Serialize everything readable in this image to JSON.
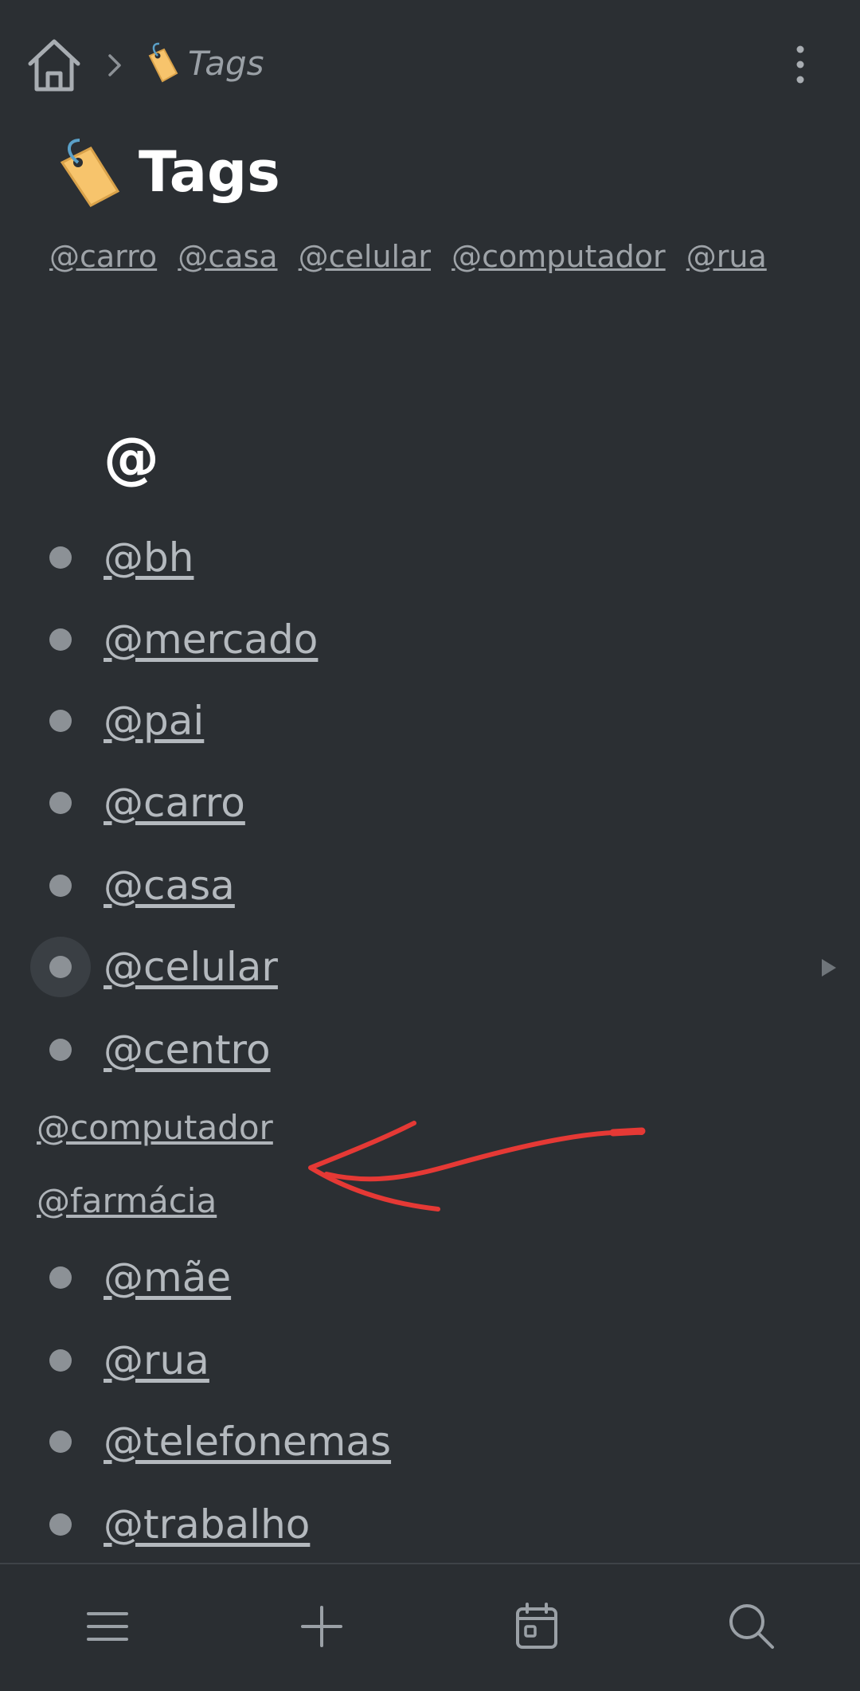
{
  "breadcrumb": {
    "label": "Tags"
  },
  "page": {
    "title": "Tags"
  },
  "tag_row": [
    "@carro",
    "@casa",
    "@celular",
    "@computador",
    "@rua"
  ],
  "section_heading": "@",
  "list_items": [
    {
      "label": "@bh"
    },
    {
      "label": "@mercado"
    },
    {
      "label": "@pai"
    },
    {
      "label": "@carro"
    },
    {
      "label": "@casa"
    },
    {
      "label": "@celular"
    },
    {
      "label": "@centro"
    }
  ],
  "loose_items": [
    {
      "label": "@computador"
    },
    {
      "label": "@farmácia"
    }
  ],
  "list_items_after": [
    {
      "label": "@mãe"
    },
    {
      "label": "@rua"
    },
    {
      "label": "@telefonemas"
    },
    {
      "label": "@trabalho"
    }
  ],
  "icons": {
    "home": "home-icon",
    "chevron": "chevron-right-icon",
    "tag": "tag-emoji-icon",
    "more": "more-vertical-icon",
    "menu": "menu-icon",
    "add": "plus-icon",
    "calendar": "calendar-icon",
    "search": "search-icon",
    "expand": "triangle-right-icon"
  },
  "colors": {
    "background": "#2b2f33",
    "bullet": "#8c9196",
    "annotation_arrow": "#e53935",
    "tag_emoji": "#f7c46c"
  }
}
